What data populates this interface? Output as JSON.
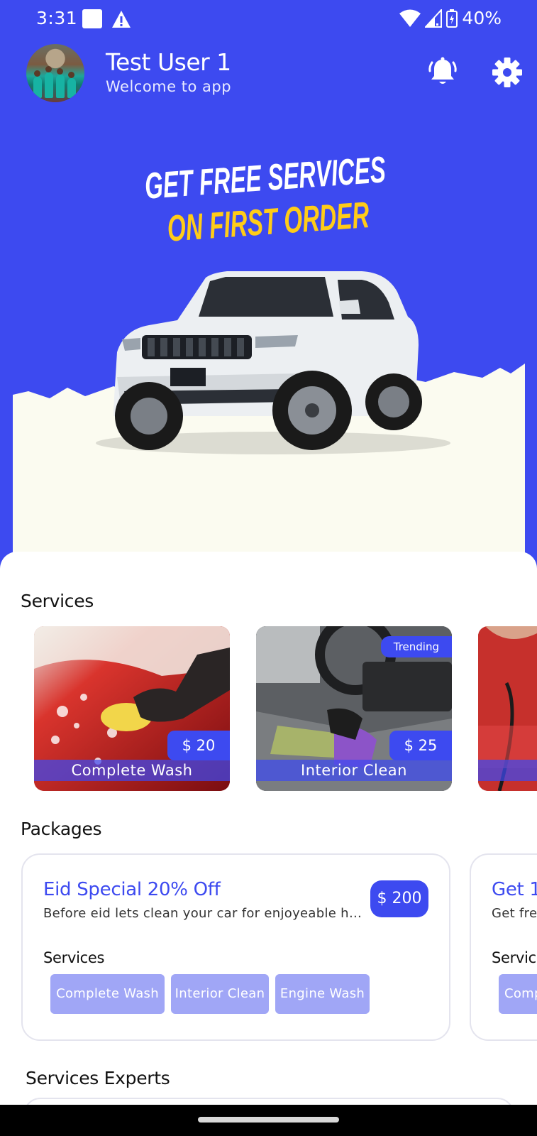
{
  "status_bar": {
    "time": "3:31",
    "battery": "40%"
  },
  "header": {
    "user_name": "Test User 1",
    "welcome": "Welcome to app"
  },
  "banner": {
    "line1": "GET FREE SERVICES",
    "line2": "ON FIRST ORDER"
  },
  "services": {
    "title": "Services",
    "items": [
      {
        "label": "Complete Wash",
        "price": "$ 20"
      },
      {
        "label": "Interior Clean",
        "price": "$ 25",
        "badge": "Trending"
      }
    ]
  },
  "packages": {
    "title": "Packages",
    "items": [
      {
        "title": "Eid Special  20% Off",
        "description": "Before eid lets clean your car for enjoyeable holidays",
        "price": "$ 200",
        "services_label": "Services",
        "chips": [
          "Complete Wash",
          "Interior Clean",
          "Engine Wash"
        ]
      },
      {
        "title": "Get 1",
        "description": "Get fre",
        "services_label": "Servic",
        "chips": [
          "Comp"
        ]
      }
    ]
  },
  "experts": {
    "title": "Services Experts"
  },
  "colors": {
    "primary": "#3d4af0",
    "accent_yellow": "#ffcc18",
    "chip": "#a0a6f6"
  }
}
